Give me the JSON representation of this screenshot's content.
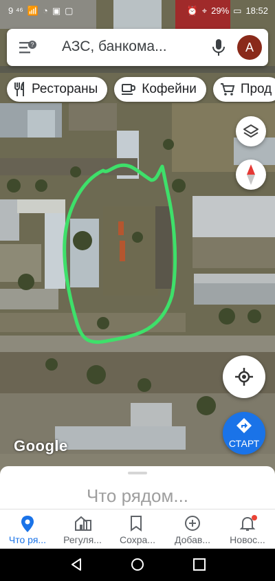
{
  "status_bar": {
    "left_text": "9 ⁴⁶",
    "battery": "29%",
    "time": "18:52"
  },
  "search": {
    "text": "АЗС, банкома...",
    "avatar_letter": "A"
  },
  "chips": [
    {
      "label": "Рестораны",
      "icon": "restaurant-icon"
    },
    {
      "label": "Кофейни",
      "icon": "coffee-icon"
    },
    {
      "label": "Прод",
      "icon": "cart-icon"
    }
  ],
  "map": {
    "logo": "Google",
    "start_label": "СТАРТ",
    "annotation_color": "#3ee06a"
  },
  "sheet": {
    "title": "Что рядом..."
  },
  "nav": [
    {
      "label": "Что ря...",
      "icon": "explore-pin-icon",
      "active": true
    },
    {
      "label": "Регуля...",
      "icon": "commute-icon",
      "active": false
    },
    {
      "label": "Сохра...",
      "icon": "bookmark-icon",
      "active": false
    },
    {
      "label": "Добав...",
      "icon": "add-circle-icon",
      "active": false
    },
    {
      "label": "Новос...",
      "icon": "bell-icon",
      "active": false
    }
  ],
  "colors": {
    "accent": "#1a73e8",
    "notification_dot": "#ea4335"
  }
}
